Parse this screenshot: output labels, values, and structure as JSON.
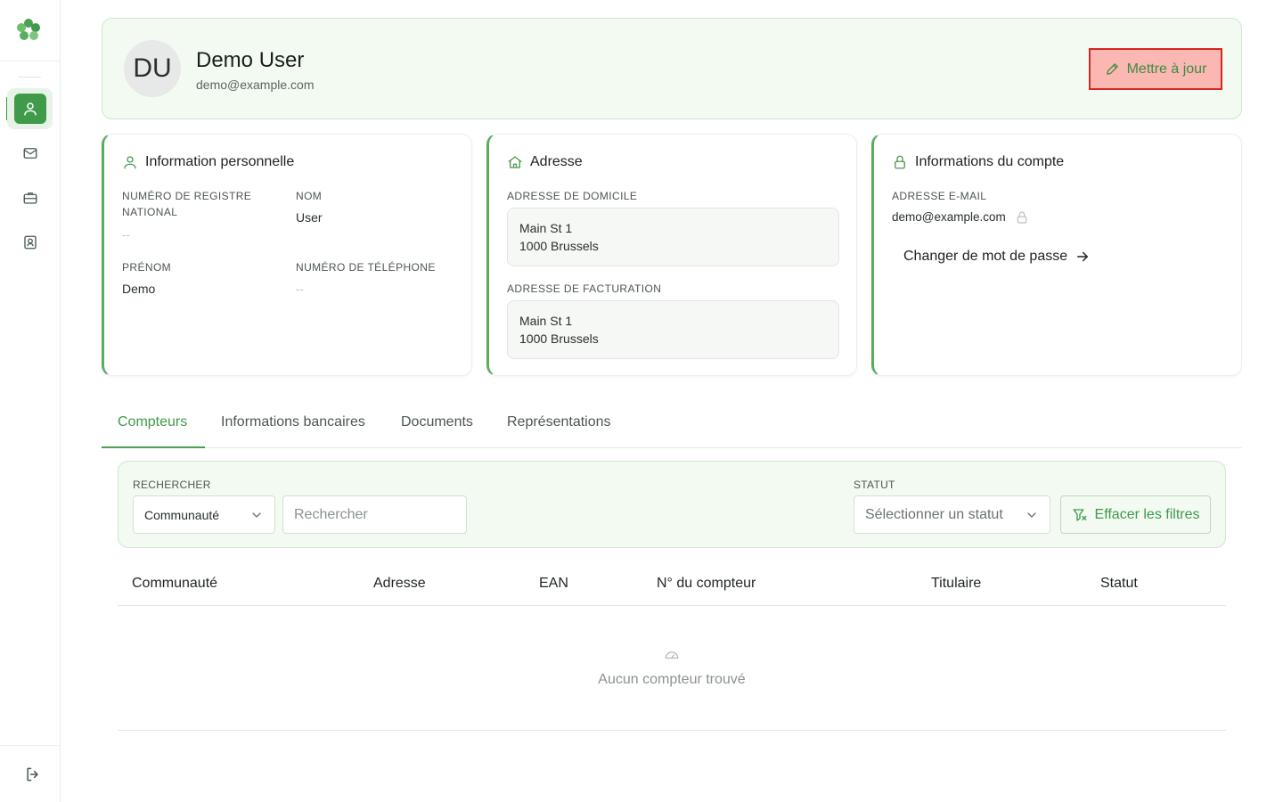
{
  "sidebar": {
    "items": [
      {
        "name": "profile",
        "icon": "user-icon",
        "active": true
      },
      {
        "name": "messages",
        "icon": "mail-icon",
        "active": false
      },
      {
        "name": "briefcase",
        "icon": "briefcase-icon",
        "active": false
      },
      {
        "name": "contacts",
        "icon": "contact-card-icon",
        "active": false
      }
    ],
    "logout_icon": "logout-icon"
  },
  "profile": {
    "initials": "DU",
    "name": "Demo User",
    "email": "demo@example.com",
    "update_label": "Mettre à jour"
  },
  "personal": {
    "title": "Information personnelle",
    "national_register_label": "Numéro de registre national",
    "national_register_value": "--",
    "last_name_label": "Nom",
    "last_name_value": "User",
    "first_name_label": "Prénom",
    "first_name_value": "Demo",
    "phone_label": "Numéro de téléphone",
    "phone_value": "--"
  },
  "address": {
    "title": "Adresse",
    "home_label": "Adresse de domicile",
    "home_line1": "Main St 1",
    "home_line2": "1000 Brussels",
    "billing_label": "Adresse de facturation",
    "billing_line1": "Main St 1",
    "billing_line2": "1000 Brussels"
  },
  "account": {
    "title": "Informations du compte",
    "email_label": "Adresse e-mail",
    "email_value": "demo@example.com",
    "change_password": "Changer de mot de passe"
  },
  "tabs": [
    {
      "label": "Compteurs",
      "active": true
    },
    {
      "label": "Informations bancaires",
      "active": false
    },
    {
      "label": "Documents",
      "active": false
    },
    {
      "label": "Représentations",
      "active": false
    }
  ],
  "filters": {
    "search_label": "RECHERCHER",
    "community_select": "Communauté",
    "search_placeholder": "Rechercher",
    "status_label": "STATUT",
    "status_placeholder": "Sélectionner un statut",
    "clear_label": "Effacer les filtres"
  },
  "table": {
    "columns": [
      "Communauté",
      "Adresse",
      "EAN",
      "N° du compteur",
      "Titulaire",
      "Statut"
    ],
    "empty_text": "Aucun compteur trouvé"
  },
  "colors": {
    "accent": "#3f9a4a",
    "panel_bg": "#f3faf2",
    "highlight_border": "#d6261f",
    "highlight_bg": "#fbb7b2"
  }
}
